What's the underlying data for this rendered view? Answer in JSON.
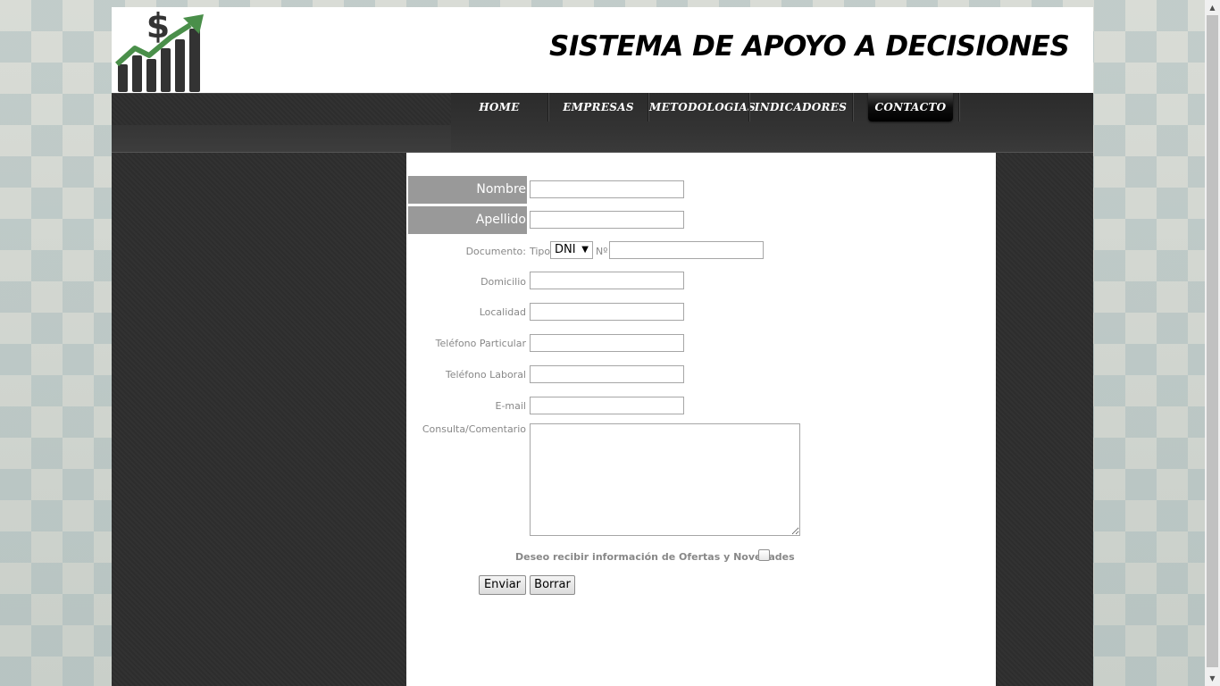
{
  "header": {
    "title": "SISTEMA DE APOYO A DECISIONES",
    "logo_icon": "dollar-growth-chart-icon"
  },
  "nav": {
    "items": [
      {
        "label": "HOME"
      },
      {
        "label": "EMPRESAS"
      },
      {
        "label": "METODOLOGIAS"
      },
      {
        "label": "INDICADORES"
      },
      {
        "label": "CONTACTO",
        "active": true
      }
    ]
  },
  "form": {
    "nombre_label": "Nombre",
    "nombre_value": "",
    "apellido_label": "Apellido",
    "apellido_value": "",
    "documento_label": "Documento:",
    "tipo_label": "Tipo",
    "tipo_selected": "DNI",
    "numero_label": "Nº",
    "numero_value": "",
    "domicilio_label": "Domicilio",
    "localidad_label": "Localidad",
    "tel_particular_label": "Teléfono Particular",
    "tel_laboral_label": "Teléfono Laboral",
    "email_label": "E-mail",
    "consulta_label": "Consulta/Comentario",
    "consulta_value": "",
    "newsletter_label": "Deseo recibir información de Ofertas y Novedades",
    "newsletter_checked": false,
    "submit_label": "Enviar",
    "reset_label": "Borrar"
  },
  "colors": {
    "label_box_bg": "#999999",
    "dark_bg": "#2e2e2e",
    "logo_green": "#4a8f4a",
    "logo_dark": "#333333"
  }
}
